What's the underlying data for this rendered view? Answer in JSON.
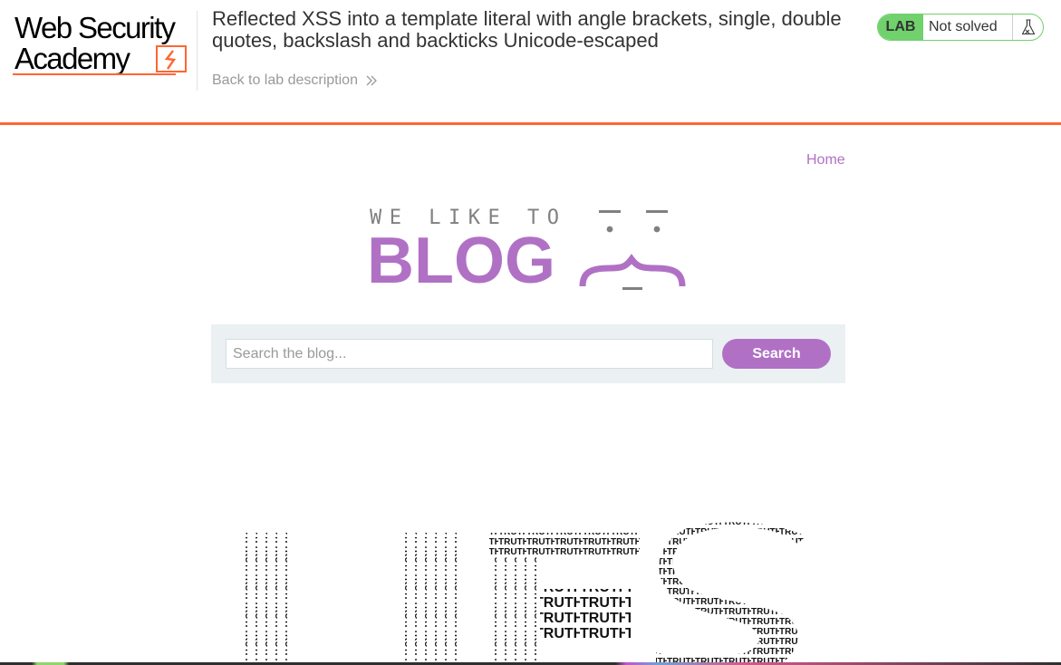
{
  "academy": {
    "logo_line1": "Web Security",
    "logo_line2": "Academy",
    "lab_title": "Reflected XSS into a template literal with angle brackets, single, double quotes, backslash and backticks Unicode-escaped",
    "back_link": "Back to lab description",
    "status_badge": "LAB",
    "status_text": "Not solved",
    "accent_color": "#ff6633",
    "badge_color": "#70d16d"
  },
  "blog": {
    "nav_home": "Home",
    "logo_tagline": "WE LIKE TO",
    "logo_name": "BLOG",
    "brand_color": "#b071c5",
    "search": {
      "placeholder": "Search the blog...",
      "button_label": "Search"
    },
    "post_image": {
      "big_letters": [
        "L",
        "I",
        "E",
        "S"
      ],
      "word": "TRUTH"
    }
  }
}
